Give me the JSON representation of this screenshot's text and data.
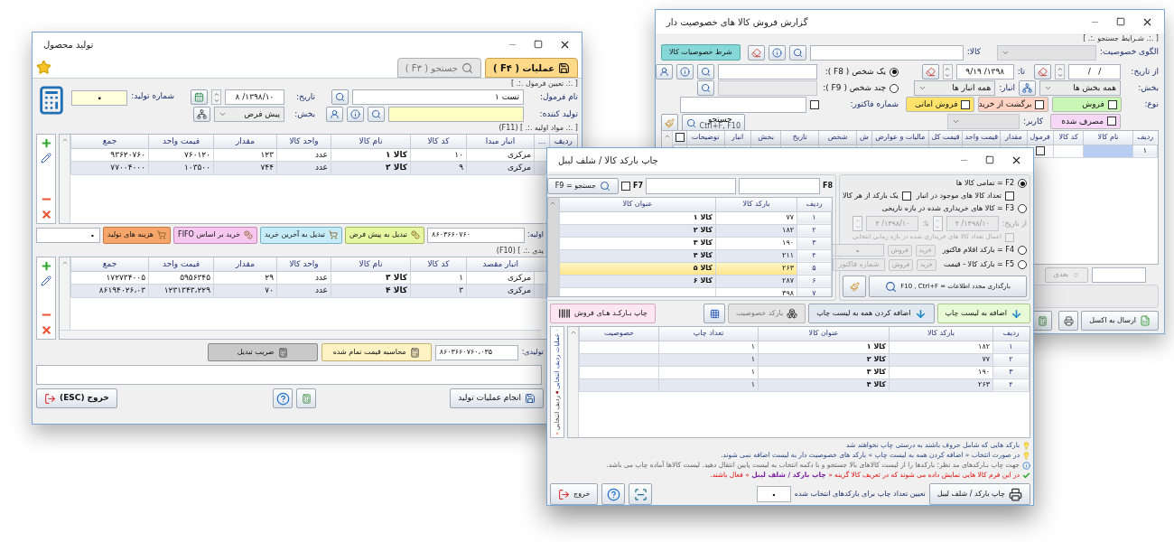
{
  "report_window": {
    "title": "گزارش فروش کالا های خصوصیت دار",
    "section_title": "[ .:. شـرایط جستجو .:. ]",
    "pattern_label": "الگوی خصوصیت:",
    "product_label": "کالا:",
    "product_button": "شرط خصوصیات کالا",
    "date_from": {
      "label": "از تاریخ:",
      "value": "/   /"
    },
    "date_to": {
      "label": "تا:",
      "value": "۱۳۹۸/ ۹/۱۹"
    },
    "section": {
      "label": "بخش:",
      "value": "همه بخش ها"
    },
    "warehouse": {
      "label": "انبار:",
      "value": "همه انبار ها"
    },
    "type_label": "نوع:",
    "types": [
      {
        "label": "فروش",
        "checked": false,
        "color": "#c9f7b5"
      },
      {
        "label": "برگشت از خرید",
        "checked": false,
        "color": "#ffd3c4"
      },
      {
        "label": "فروش امانی",
        "checked": false,
        "color": "#ffe36b"
      },
      {
        "label": "مصرف شده",
        "checked": false,
        "color": "#f6d8f6"
      }
    ],
    "user_label": "کاربر:",
    "person_modes": [
      {
        "label": "یک شخص ( F8 ):",
        "selected": true
      },
      {
        "label": "چند شخص ( F9 ):",
        "selected": false
      }
    ],
    "invoice": {
      "label": "شماره فاکتور:",
      "checked": false
    },
    "search_button": {
      "label": "جستجو",
      "shortcut": "Ctrl+F, F10"
    },
    "table": {
      "columns": [
        "ردیف",
        "نام کالا",
        "کد کالا",
        "فرمول",
        "مقدار",
        "قیمت واحد",
        "قیمت کل",
        "مالیات و عوارض",
        "ش",
        "شخص",
        "تاریخ",
        "بخش",
        "انبار",
        "توضیحات"
      ],
      "select_all": false,
      "rows": [
        {
          "index": "۱",
          "selected": true,
          "formula_checked": false
        }
      ]
    },
    "next_button": "بعدی",
    "excel_button": "ارسال به اکسل"
  },
  "production_window": {
    "title": "تولید محصول",
    "tabs": [
      {
        "label": "عملیات ( F۴ )",
        "selected": true
      },
      {
        "label": "جستجو ( F۳ )",
        "selected": false
      }
    ],
    "formula_section": "[ .:. تعیین فرمول .:. ]",
    "formula_name": {
      "label": "نام فرمول:",
      "value": "تست ۱"
    },
    "producer": {
      "label": "تولید کننده:"
    },
    "date": {
      "label": "تاریخ:",
      "value": "۱۳۹۸/۱۰/ ۸"
    },
    "section": {
      "label": "بخش:",
      "value": "پیش فرض"
    },
    "production_number": {
      "label": "شماره تولید:",
      "value": "۰"
    },
    "materials": {
      "title": "[ .:. مواد اولیه .:. ] (F11)",
      "columns": [
        "ردیف",
        "...",
        "انبار مبدا",
        "کد کالا",
        "نام کالا",
        "واحد کالا",
        "مقدار",
        "قیمت واحد",
        "جمع"
      ],
      "rows": [
        [
          "",
          "",
          "مرکزی",
          "۱۰",
          "کالا ۱",
          "عدد",
          "۱۲۳",
          "۷۶۰۱۲۰",
          "۹۳۶۲۰۷۶۰"
        ],
        [
          "",
          "",
          "مرکزی",
          "۹",
          "کالا ۲",
          "عدد",
          "۷۴۴",
          "۱۰۳۵۰۰",
          "۷۷۰۰۴۰۰۰"
        ]
      ]
    },
    "cost_bar": {
      "label": "اولیه:",
      "total": "۸۶۰۳۶۶۰۷۶۰",
      "buttons": [
        "تبدیل به پیش فرض",
        "تبدیل به آخرین خرید",
        "خرید بر اساس FIFO",
        "هزینه های تولید"
      ],
      "value": "۰"
    },
    "products": {
      "title": "یدی .:. ] (F10)",
      "columns": [
        "انبار مقصد",
        "کد کالا",
        "نام کالا",
        "واحد کالا",
        "مقدار",
        "قیمت واحد",
        "جمع"
      ],
      "rows": [
        [
          "مرکزی",
          "۱",
          "کالا ۳",
          "عدد",
          "۲۹",
          "۵۹۵۶۳۴۵",
          "۱۷۲۷۳۴۰۰۵"
        ],
        [
          "مرکزی",
          "۳",
          "کالا ۴",
          "عدد",
          "۷۰",
          "۱۲۳۱۳۴۳،۲۲۹",
          "۸۶۱۹۴۰۲۶،۰۳"
        ]
      ]
    },
    "product_bar": {
      "label": "تولیدی:",
      "total": "۸۶۰۳۶۶۰۷۶۰،۰۳۵",
      "calc_button": "محاسبه قیمت تمام شده",
      "factor_button": "ضریب تبدیل"
    },
    "run_button": "انجام عملیات تولید",
    "exit_button": "خروج (ESC)"
  },
  "barcode_window": {
    "title": "چاپ بارکد کالا / شلف لیبل",
    "modes": [
      {
        "label": "F2 = تمامی کالا ها",
        "selected": true
      },
      {
        "label": "F3 = کالا های خریداری شده در بازه تاریخی",
        "selected": false
      },
      {
        "label": "F4 = بارکد اقلام فاکتور",
        "selected": false
      },
      {
        "label": "F5 = بارکد کالا - قیمت",
        "selected": false
      }
    ],
    "stock_count": {
      "label": "تعداد کالا های موجود در انبار",
      "checked": false
    },
    "one_per_item": {
      "label": "یک بارکد از هر کالا",
      "checked": false
    },
    "date_from": {
      "label": "از تاریخ:",
      "value": "۱۳۹۸/۱۰/ ۴"
    },
    "date_to": {
      "label": "تا:",
      "value": "۱۳۹۸/۱۰/ ۴"
    },
    "apply_count": {
      "label": "اعمال تعداد کالا های خریداری شده در بازه زمانی انتخابی",
      "checked": false,
      "disabled": true
    },
    "invoice_row": {
      "buy": "خرید",
      "sell": "فروش",
      "value": "۰"
    },
    "price_row": {
      "buy": "خرید",
      "sell": "فروش",
      "placeholder": "شماره فاکتور"
    },
    "reload_button": "بارگذاری مجدد اطلاعات = F10 , Ctrl+F",
    "f8_label": "F8",
    "f7": {
      "label": "F7",
      "checked": false
    },
    "search_button": "جستجو = F9",
    "list": {
      "columns": [
        "ردیف",
        "بارکد کالا",
        "عنوان کالا"
      ],
      "rows": [
        {
          "index": "۱",
          "barcode": "۷۷",
          "name": "کالا ۱",
          "selected": false
        },
        {
          "index": "۲",
          "barcode": "۱۸۲",
          "name": "کالا ۲",
          "selected": false
        },
        {
          "index": "۳",
          "barcode": "۱۹۰",
          "name": "کالا ۳",
          "selected": false
        },
        {
          "index": "۴",
          "barcode": "۲۱۱",
          "name": "کالا ۴",
          "selected": false
        },
        {
          "index": "۵",
          "barcode": "۲۶۳",
          "name": "کالا ۵",
          "selected": true
        },
        {
          "index": "۶",
          "barcode": "۲۸۷",
          "name": "کالا ۶",
          "selected": false
        },
        {
          "index": "۷",
          "barcode": "۳۹۸",
          "selected": false
        }
      ]
    },
    "actions": [
      {
        "label": "اضافه به لیست چاپ",
        "disabled": false
      },
      {
        "label": "اضافه کردن همه به لیست چاپ",
        "disabled": false
      },
      {
        "label": "بارکد خصوصیت",
        "disabled": true
      }
    ],
    "sales_barcode_button": "چاپ بـارکـد هـای فروش",
    "side_labels": [
      "عملیات ردیف انتخابی",
      "ردیف انتخابی"
    ],
    "print_list": {
      "columns": [
        "ردیف",
        "بارکد کالا",
        "عنوان کالا",
        "تعداد چاپ",
        "خصوصیت"
      ],
      "rows": [
        {
          "index": "۱",
          "barcode": "۱۸۲",
          "name": "کالا ۱",
          "copies": "۱"
        },
        {
          "index": "۲",
          "barcode": "۷۷",
          "name": "کالا ۲",
          "copies": "۱"
        },
        {
          "index": "۳",
          "barcode": "۱۹۰",
          "name": "کالا ۳",
          "copies": "۱"
        },
        {
          "index": "۴",
          "barcode": "۲۶۳",
          "name": "کالا ۴",
          "copies": "۱"
        }
      ]
    },
    "notes": [
      {
        "kind": "tip",
        "text": "بارکد هایی که شامل حروف باشند به درستی چاپ نخواهند شد"
      },
      {
        "kind": "tip",
        "text": "در صورت انتخاب « اضافه کردن همه به لیست چاپ » بارکد های خصوصیت دار به لیست اضافه نمی شوند."
      },
      {
        "kind": "info",
        "text": "جهت چاپ بـارکدهای مد نظر؛ بارکدها را از لیست کالاهای بالا جستجو و با دکمه انتخاب به لیست پایین انتقال دهید. لیست کالاها آماده چاپ می باشد."
      },
      {
        "kind": "check",
        "text": "در این فرم کالا هایی نمایش داده می شوند که در تعریف کالا گزینه « **چاپ بارکد / شلف لیبل** » فعال باشند."
      }
    ],
    "print_button": "چاپ بارکد / شلف لیبل",
    "copies_label": "تعیین تعداد چاپ برای بارکدهای انتخاب شده",
    "copies_value": "۰",
    "exit_button": "خروج"
  }
}
